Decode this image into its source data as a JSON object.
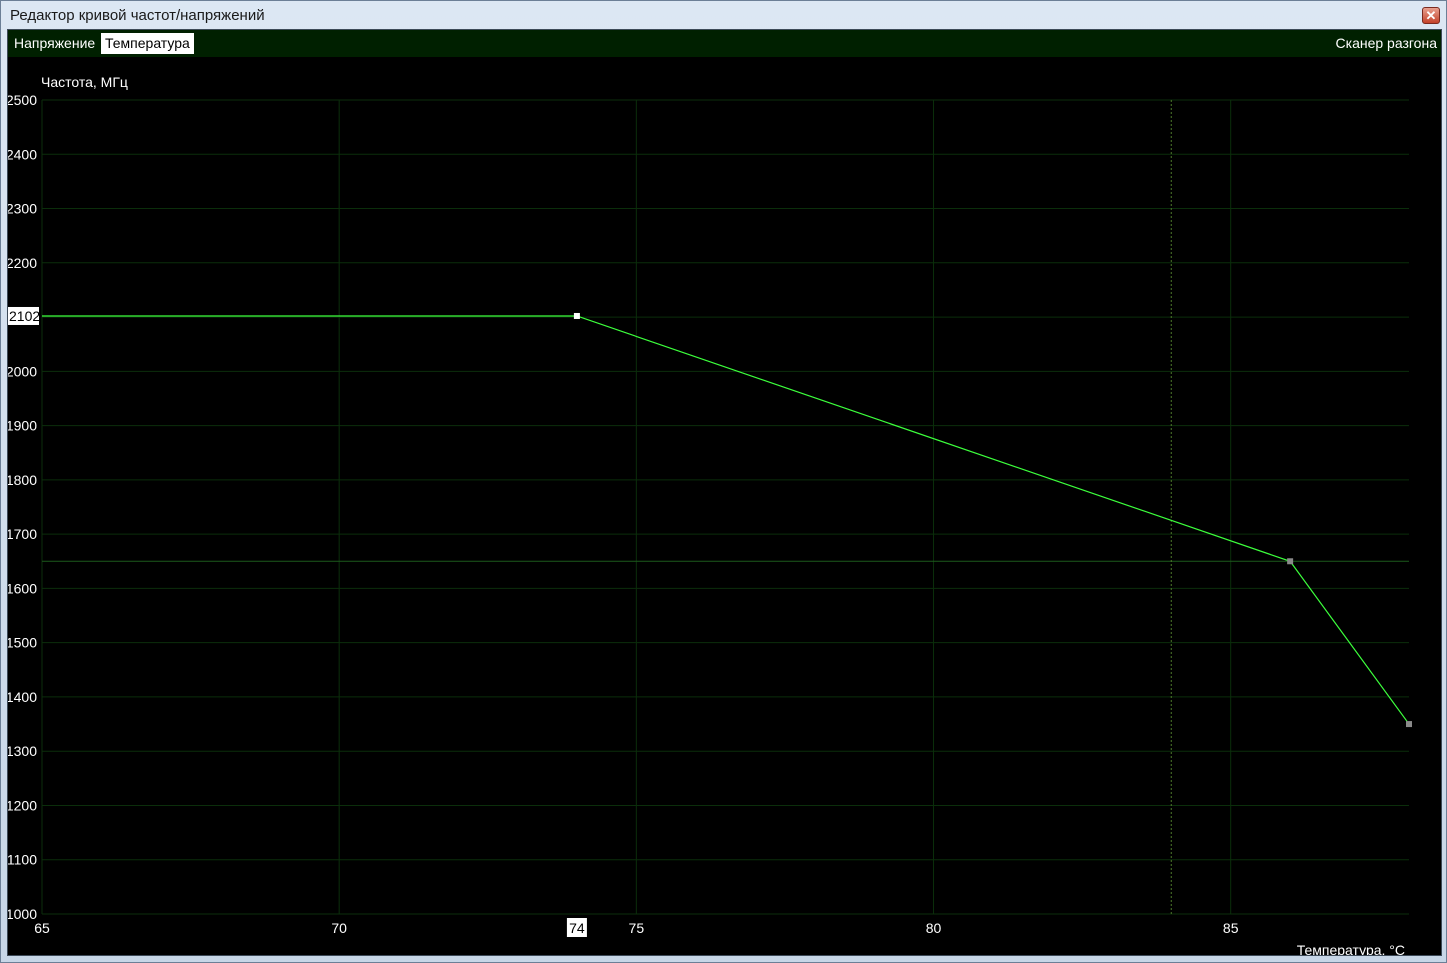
{
  "window": {
    "title": "Редактор кривой частот/напряжений",
    "close_label": "✕"
  },
  "toolbar": {
    "tabs": [
      {
        "label": "Напряжение",
        "active": false
      },
      {
        "label": "Температура",
        "active": true
      }
    ],
    "scanner_label": "Сканер разгона"
  },
  "colors": {
    "background": "#000000",
    "grid": "#0b2e0b",
    "curve": "#3cff3c",
    "toolbar": "#002000"
  },
  "chart_data": {
    "type": "line",
    "ylabel": "Частота, МГц",
    "xlabel": "Температура, °C",
    "xlim": [
      65,
      88
    ],
    "ylim": [
      1000,
      2500
    ],
    "x_ticks": [
      65,
      70,
      75,
      80,
      85
    ],
    "y_ticks": [
      1000,
      1100,
      1200,
      1300,
      1400,
      1500,
      1600,
      1700,
      1800,
      1900,
      2000,
      2100,
      2200,
      2300,
      2400,
      2500
    ],
    "y_tick_labels": [
      "1000",
      "1100",
      "1200",
      "1300",
      "1400",
      "1500",
      "1600",
      "1700",
      "1800",
      "1900",
      "2000",
      "2100",
      "2200",
      "2300",
      "2400",
      "2500"
    ],
    "series": [
      {
        "x": [
          65,
          74,
          86,
          88
        ],
        "y": [
          2102,
          2102,
          1650,
          1350
        ]
      }
    ],
    "selected_point": {
      "x": 74,
      "y": 2102,
      "x_label": "74",
      "y_label": "2102"
    },
    "horizontal_marker": 1650,
    "vertical_marker": 84,
    "grid": true
  }
}
